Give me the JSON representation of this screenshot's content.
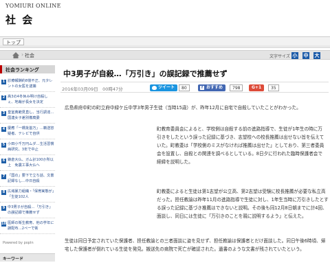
{
  "header": {
    "brand": "YOMIURI ONLINE",
    "section": "社 会"
  },
  "nav": {
    "top_tab": "トップ"
  },
  "breadcrumb": {
    "home_icon": "home-icon",
    "current": "社会",
    "font_size_label": "文字サイズ",
    "font_small": "小",
    "font_medium": "中",
    "font_large": "大"
  },
  "sidebar": {
    "ranking_title": "社会ランキング",
    "ranking": [
      {
        "num": "1",
        "text": "診療報酬約8億不正、元タレントの女医を逮捕"
      },
      {
        "num": "2",
        "text": "高3の4冬休み明け自殺しぇ、地裁が長女を決定"
      },
      {
        "num": "3",
        "text": "皇室典範見直し、当行調達…国連女子差別撤廃委"
      },
      {
        "num": "4",
        "text": "慶應「一橋批首万」…籍送容疑者、テレビで自供"
      },
      {
        "num": "5",
        "text": "小田小千万円ムダ…生活習慣病研究、3年で中止"
      },
      {
        "num": "6",
        "text": "鎌倉大仏、ガム計100か所以上　免震工事大仏へ"
      },
      {
        "num": "7",
        "text": "「国の」要下で立ち話、文書記録なし…中日自殺"
      },
      {
        "num": "8",
        "text": "広域暴力組織・「保育実態が」「生徒102人"
      },
      {
        "num": "9",
        "text": "中3男子が自殺…「万引き」の誤記録で推薦せず"
      },
      {
        "num": "10",
        "text": "医師の衛生教育、他の学年に誤配布…2ペーで衛"
      }
    ],
    "powered": "Powered by popIn",
    "keyword_title": "キーワード"
  },
  "article": {
    "headline": "中3男子が自殺…「万引き」の誤記録で推薦せず",
    "date": "2016年03月09日　00時47分",
    "tweet_label": "ツイート",
    "tweet_count": "80",
    "fb_label": "おすすめ",
    "fb_count": "798",
    "gplus_label": "G+1",
    "gplus_count": "35",
    "paragraphs": [
      "広島県府中町の町立府中緑ケ丘中学3年男子生徒（当時15歳）が、昨年12月に自宅で自殺していたことがわかった。",
      "町教育委員会によると、学校側は自殺する前の進路指導で、生徒が1年生の時に万引きをしたという誤った記録に基づき、志望校への校長推薦は出せない旨を伝えていた。町教委は「学校側のミスがなければ推薦は出せた」としており、第三者委員会を設置し、自殺との関連を調べるとしている。8日夕に行われた臨時保護者会で経緯を説明した。",
      "町教委によると生徒は第1志望が公立高、第2志望は受験に校長推薦が必要な私立高だった。担任教諭は昨年11月の進路指導で生徒に対し、1年生当時に万引きしたとする誤った記録に基づき推薦はできないと説明。その後も同12月8日朝までに計4回、面談し、同日には生徒に「万引きのことを親に説明するよう」と伝えた。",
      "生徒は同日予定されていた保護者、担任教諭との三者面談に姿を見せず、担任教諭は保護者とだけ面談した。同日午後6時頃、帰宅した保護者が倒れている生徒を発見。搬送先の病院で死亡が確認された。遺書のような文書が残されていたという。"
    ]
  }
}
